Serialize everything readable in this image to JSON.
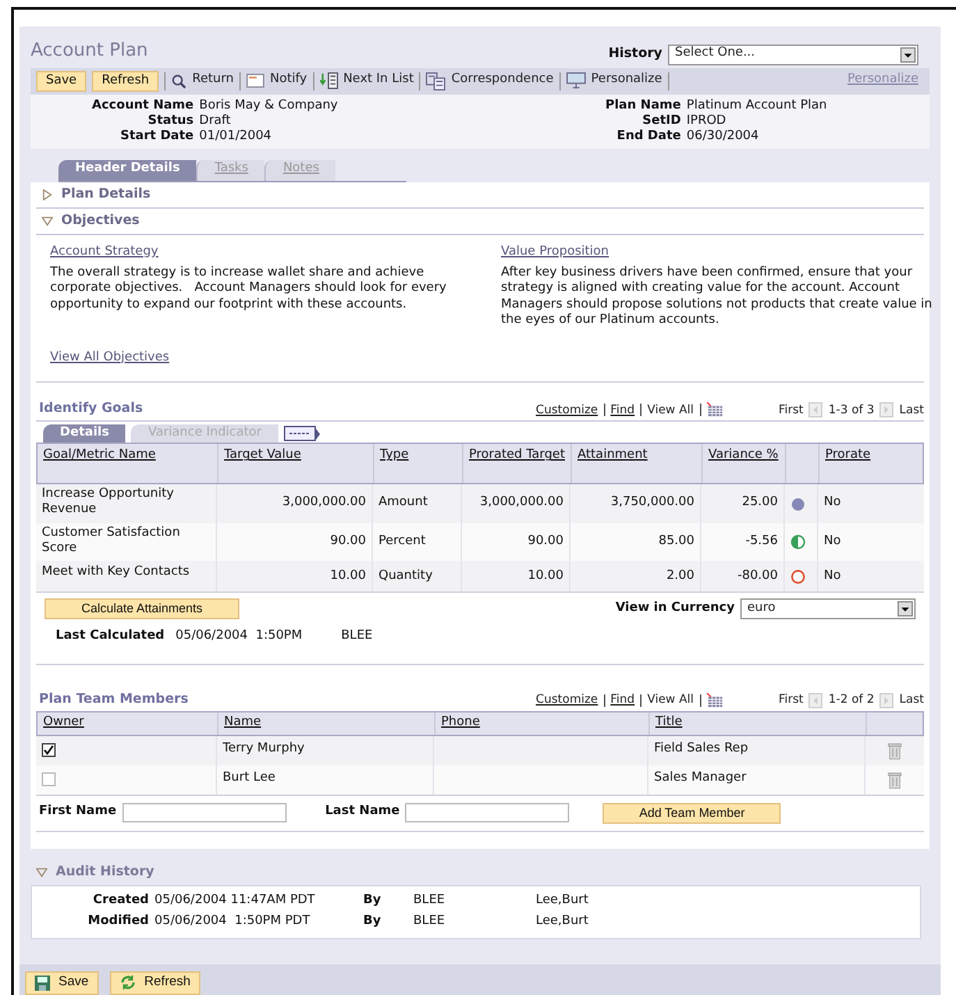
{
  "page_title": "Account Plan",
  "history": {
    "label": "History",
    "value": "Select One..."
  },
  "toolbar": {
    "buttons": [
      "Save",
      "Refresh"
    ],
    "actions": [
      {
        "kind": "search",
        "label": "Return"
      },
      {
        "kind": "envelope",
        "label": "Notify"
      },
      {
        "kind": "list",
        "label": "Next In List"
      },
      {
        "kind": "documents",
        "label": "Correspondence"
      },
      {
        "kind": "monitor",
        "label": "Personalize"
      }
    ],
    "personalize_link": "Personalize"
  },
  "summary": [
    {
      "label": "Account Name",
      "value": "Boris May & Company"
    },
    {
      "label": "Status",
      "value": "Draft"
    },
    {
      "label": "Start Date",
      "value": "01/01/2004"
    },
    {
      "label": "Plan Name",
      "value": "Platinum Account Plan"
    },
    {
      "label": "SetID",
      "value": "IPROD"
    },
    {
      "label": "End Date",
      "value": "06/30/2004"
    }
  ],
  "tabs": [
    {
      "label": "Header Details",
      "selected": true
    },
    {
      "label": "Tasks",
      "selected": false
    },
    {
      "label": "Notes",
      "selected": false
    }
  ],
  "plan_details": {
    "title": "Plan Details",
    "expanded": false
  },
  "objectives": {
    "title": "Objectives",
    "expanded": true,
    "items": [
      {
        "title": "Account Strategy",
        "text": "The overall strategy is to increase wallet share and achieve corporate objectives.   Account Managers should look for every opportunity to expand our footprint with these accounts."
      },
      {
        "title": "Value Proposition",
        "text": "After key business drivers have been confirmed, ensure that your strategy is aligned with creating value for the account. Account Managers should propose solutions not products that create value in the eyes of our Platinum accounts."
      }
    ],
    "view_all": "View All Objectives"
  },
  "goals": {
    "title": "Identify Goals",
    "nav": {
      "links": [
        "Customize",
        "Find",
        "View All"
      ],
      "first": "First",
      "range": "1-3 of 3",
      "last": "Last"
    },
    "tabs": [
      {
        "label": "Details",
        "selected": true
      },
      {
        "label": "Variance Indicator",
        "selected": false
      }
    ],
    "columns": [
      "Goal/Metric Name",
      "Target Value",
      "Type",
      "Prorated Target",
      "Attainment",
      "Variance %",
      "Prorate"
    ],
    "rows": [
      {
        "name": "Increase Opportunity Revenue",
        "target": "3,000,000.00",
        "type": "Amount",
        "prorated": "3,000,000.00",
        "attainment": "3,750,000.00",
        "variance": "25.00",
        "indicator": {
          "kind": "filled",
          "color": "#8888b8"
        },
        "prorate": "No"
      },
      {
        "name": "Customer Satisfaction Score",
        "target": "90.00",
        "type": "Percent",
        "prorated": "90.00",
        "attainment": "85.00",
        "variance": "-5.56",
        "indicator": {
          "kind": "half",
          "color": "#3aa05a"
        },
        "prorate": "No"
      },
      {
        "name": "Meet with Key Contacts",
        "target": "10.00",
        "type": "Quantity",
        "prorated": "10.00",
        "attainment": "2.00",
        "variance": "-80.00",
        "indicator": {
          "kind": "ring",
          "color": "#e05030"
        },
        "prorate": "No"
      }
    ],
    "calculate_button": "Calculate Attainments",
    "currency": {
      "label": "View in Currency",
      "value": "euro"
    },
    "last_calculated": {
      "label": "Last Calculated",
      "date": "05/06/2004  1:50PM",
      "user": "BLEE"
    }
  },
  "team": {
    "title": "Plan Team Members",
    "nav": {
      "links": [
        "Customize",
        "Find",
        "View All"
      ],
      "first": "First",
      "range": "1-2 of 2",
      "last": "Last"
    },
    "columns": [
      "Owner",
      "Name",
      "Phone",
      "Title"
    ],
    "rows": [
      {
        "owner": true,
        "name": "Terry Murphy",
        "title": "Field Sales Rep"
      },
      {
        "owner": false,
        "name": "Burt Lee",
        "title": "Sales Manager"
      }
    ],
    "first_name": {
      "label": "First Name"
    },
    "last_name": {
      "label": "Last Name"
    },
    "add_button": "Add Team Member"
  },
  "audit": {
    "title": "Audit History",
    "expanded": true,
    "rows": [
      {
        "label": "Created",
        "date": "05/06/2004 11:47AM PDT",
        "by_label": "By",
        "user": "BLEE",
        "name": "Lee,Burt"
      },
      {
        "label": "Modified",
        "date": "05/06/2004  1:50PM PDT",
        "by_label": "By",
        "user": "BLEE",
        "name": "Lee,Burt"
      }
    ]
  },
  "footer_buttons": [
    {
      "kind": "save",
      "label": "Save"
    },
    {
      "kind": "refresh",
      "label": "Refresh"
    }
  ]
}
